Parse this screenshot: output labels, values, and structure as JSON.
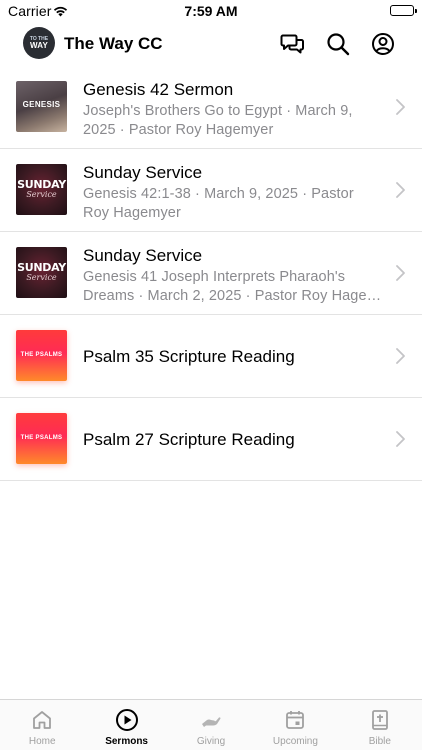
{
  "status": {
    "carrier": "Carrier",
    "time": "7:59 AM"
  },
  "header": {
    "logo_line1": "TO THE",
    "logo_line2": "WAY",
    "title": "The Way CC",
    "icons": [
      "chat-icon",
      "search-icon",
      "profile-icon"
    ]
  },
  "sermons": [
    {
      "title": "Genesis 42 Sermon",
      "subtitle": "Joseph's Brothers Go to Egypt · March 9, 2025 · Pastor Roy Hagemyer",
      "thumb_text": "GENESIS"
    },
    {
      "title": "Sunday Service",
      "subtitle": "Genesis 42:1-38 · March 9, 2025 · Pastor Roy Hagemyer",
      "thumb_text": "SUNDAY",
      "thumb_script": "Service"
    },
    {
      "title": "Sunday Service",
      "subtitle": "Genesis 41 Joseph Interprets Pharaoh's Dreams · March 2, 2025 · Pastor Roy Hage…",
      "thumb_text": "SUNDAY",
      "thumb_script": "Service"
    },
    {
      "title": "Psalm 35 Scripture Reading",
      "thumb_text": "THE PSALMS"
    },
    {
      "title": "Psalm 27 Scripture Reading",
      "thumb_text": "THE PSALMS"
    }
  ],
  "tabs": [
    {
      "label": "Home",
      "icon": "home-icon",
      "active": false
    },
    {
      "label": "Sermons",
      "icon": "play-circle-icon",
      "active": true
    },
    {
      "label": "Giving",
      "icon": "giving-hand-icon",
      "active": false
    },
    {
      "label": "Upcoming",
      "icon": "calendar-icon",
      "active": false
    },
    {
      "label": "Bible",
      "icon": "bible-icon",
      "active": false
    }
  ],
  "colors": {
    "active_tab": "#000000",
    "inactive_tab": "#a0a0a0",
    "subtitle": "#8a8a8e"
  }
}
